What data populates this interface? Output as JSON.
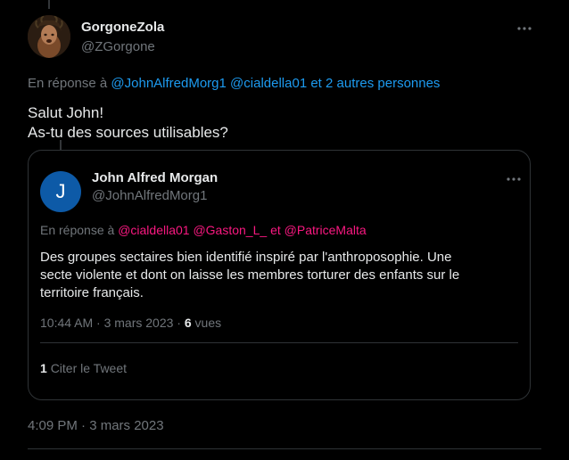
{
  "tweet": {
    "author_name": "GorgoneZola",
    "author_handle": "@ZGorgone",
    "reply_prefix": "En réponse à",
    "reply_mentions": [
      "@JohnAlfredMorg1",
      "@cialdella01"
    ],
    "reply_others": "et 2 autres personnes",
    "text_lines": [
      "Salut John!",
      "As-tu des sources utilisables?"
    ],
    "timestamp": "4:09 PM · 3 mars 2023",
    "more_icon": "more-horizontal-icon"
  },
  "quote": {
    "avatar_letter": "J",
    "avatar_color": "#0d5aa7",
    "author_name": "John Alfred Morgan",
    "author_handle": "@JohnAlfredMorg1",
    "reply_prefix": "En réponse à",
    "reply_mentions": [
      "@cialdella01",
      "@Gaston_L_",
      "@PatriceMalta"
    ],
    "reply_joiner": "et",
    "text_lines": [
      "Des groupes sectaires bien identifié inspiré par l'anthroposophie. Une",
      "secte violente et dont on laisse les membres torturer des enfants sur le",
      "territoire français."
    ],
    "meta_time": "10:44 AM · 3 mars 2023 ·",
    "views_count": "6",
    "views_label": "vues",
    "cite_count": "1",
    "cite_label": "Citer le Tweet"
  },
  "colors": {
    "background": "#000000",
    "text_primary": "#e7e9ea",
    "text_secondary": "#71767b",
    "link_blue": "#1d9bf0",
    "link_pink": "#f91880",
    "border": "#2f3336"
  }
}
